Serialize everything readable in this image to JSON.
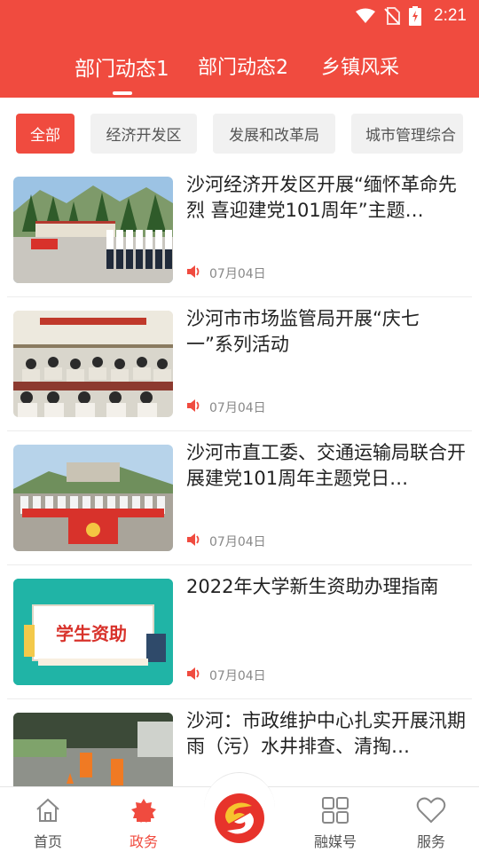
{
  "status_bar": {
    "time": "2:21",
    "icons": [
      "wifi-icon",
      "no-sim-icon",
      "battery-charging-icon"
    ]
  },
  "top_tabs": [
    {
      "label": "部门动态1",
      "active": true
    },
    {
      "label": "部门动态2",
      "active": false
    },
    {
      "label": "乡镇风采",
      "active": false
    }
  ],
  "chips": [
    {
      "label": "全部",
      "active": true
    },
    {
      "label": "经济开发区",
      "active": false
    },
    {
      "label": "发展和改革局",
      "active": false
    },
    {
      "label": "城市管理综合",
      "active": false
    }
  ],
  "news": [
    {
      "title": "沙河经济开发区开展“缅怀革命先烈 喜迎建党101周年”主题…",
      "date": "07月04日",
      "thumb": "outdoor-group-photo"
    },
    {
      "title": "沙河市市场监管局开展“庆七一”系列活动",
      "date": "07月04日",
      "thumb": "meeting-hall-photo"
    },
    {
      "title": "沙河市直工委、交通运输局联合开展建党101周年主题党日…",
      "date": "07月04日",
      "thumb": "party-flag-group-photo"
    },
    {
      "title": "2022年大学新生资助办理指南",
      "date": "07月04日",
      "thumb": "student-aid-illustration",
      "thumb_text": "学生资助"
    },
    {
      "title": "沙河：市政维护中心扎实开展汛期雨（污）水井排查、清掏…",
      "date": "",
      "thumb": "street-workers-photo"
    }
  ],
  "bottom_nav": [
    {
      "label": "首页",
      "icon": "home-icon",
      "active": false
    },
    {
      "label": "政务",
      "icon": "government-icon",
      "active": true
    },
    {
      "label": "",
      "icon": "app-logo-icon",
      "active": false
    },
    {
      "label": "融媒号",
      "icon": "grid-icon",
      "active": false
    },
    {
      "label": "服务",
      "icon": "heart-icon",
      "active": false
    }
  ],
  "colors": {
    "brand": "#f04b3f",
    "muted": "#888888"
  }
}
